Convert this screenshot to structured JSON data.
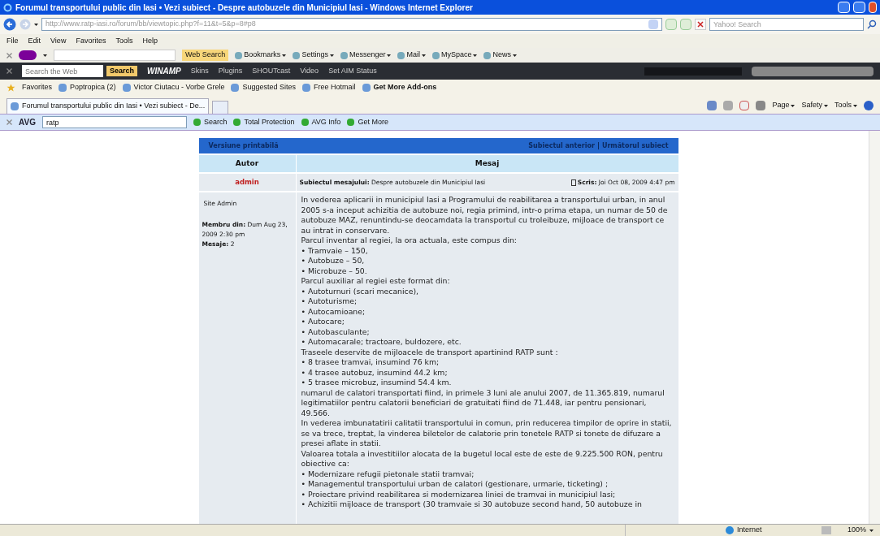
{
  "window": {
    "title": "Forumul transportului public din Iasi • Vezi subiect - Despre autobuzele din Municipiul Iasi - Windows Internet Explorer"
  },
  "address_bar": {
    "url": "http://www.ratp-iasi.ro/forum/bb/viewtopic.php?f=11&t=5&p=8#p8",
    "search_placeholder": "Yahoo! Search"
  },
  "menu": [
    "File",
    "Edit",
    "View",
    "Favorites",
    "Tools",
    "Help"
  ],
  "yahoo_toolbar": {
    "web_search": "Web Search",
    "items": [
      "Bookmarks",
      "Settings",
      "Messenger",
      "Mail",
      "MySpace",
      "News"
    ]
  },
  "winamp_toolbar": {
    "search_placeholder": "Search the Web",
    "search_button": "Search",
    "brand": "WINAMP",
    "items": [
      "Skins",
      "Plugins",
      "SHOUTcast",
      "Video",
      "Set AIM Status"
    ]
  },
  "favorites_bar": {
    "label": "Favorites",
    "items": [
      "Poptropica (2)",
      "Victor Ciutacu - Vorbe Grele",
      "Suggested Sites",
      "Free Hotmail",
      "Get More Add-ons"
    ]
  },
  "tabs": [
    {
      "label": "Forumul transportului public din Iasi • Vezi subiect - De...",
      "selected": true
    }
  ],
  "command_bar": [
    "Page",
    "Safety",
    "Tools"
  ],
  "avg_toolbar": {
    "brand": "AVG",
    "search_value": "ratp",
    "items": [
      "Search",
      "Total Protection",
      "AVG Info",
      "Get More"
    ]
  },
  "forum": {
    "printable": "Versiune printabilă",
    "nav": [
      "Subiectul anterior",
      "Următorul subiect"
    ],
    "columns": [
      "Autor",
      "Mesaj"
    ],
    "post": {
      "author": "admin",
      "subject_label": "Subiectul mesajului:",
      "subject": "Despre autobuzele din Municipiul Iasi",
      "posted_label": "Scris:",
      "posted": "Joi Oct 08, 2009 4:47 pm",
      "rank": "Site Admin",
      "member_label": "Membru din:",
      "member_since": "Dum Aug 23, 2009 2:30 pm",
      "posts_label": "Mesaje:",
      "posts": "2",
      "body": [
        "In vederea aplicarii in municipiul Iasi a Programului de reabilitarea a transportului urban, in anul 2005 s-a inceput achizitia de autobuze noi, regia primind, intr-o prima etapa, un numar de 50 de autobuze MAZ, renuntindu-se deocamdata la transportul cu troleibuze, mijloace de transport ce au intrat in conservare.",
        "Parcul inventar al regiei, la ora actuala, este compus din:",
        "• Tramvaie – 150,",
        "• Autobuze – 50,",
        "• Microbuze – 50.",
        "Parcul auxiliar al regiei este format din:",
        "• Autoturnuri (scari mecanice),",
        "• Autoturisme;",
        "• Autocamioane;",
        "• Autocare;",
        "• Autobasculante;",
        "• Automacarale; tractoare, buldozere, etc.",
        "Traseele deservite de mijloacele de transport apartinind RATP sunt :",
        "• 8 trasee tramvai, insumind 76 km;",
        "• 4 trasee autobuz, insumind 44.2 km;",
        "• 5 trasee microbuz, insumind 54.4 km.",
        "numarul de calatori transportati fiind, in primele 3 luni ale anului 2007, de 11.365.819, numarul legitimatiilor pentru calatorii beneficiari de gratuitati fiind de 71.448, iar pentru pensionari, 49.566.",
        "In vederea imbunatatirii calitatii transportului in comun, prin reducerea timpilor de oprire in statii, se va trece, treptat, la vinderea biletelor de calatorie prin tonetele RATP si tonete de difuzare a presei aflate in statii.",
        "Valoarea totala a investitiilor alocata de la bugetul local este de este de 9.225.500 RON, pentru obiective ca:",
        "• Modernizare refugii pietonale statii tramvai;",
        "• Managementul transportului urban de calatori (gestionare, urmarie, ticketing) ;",
        "• Proiectare privind reabilitarea si modernizarea liniei de tramvai in municipiul Iasi;",
        "• Achizitii mijloace de transport (30 tramvaie si 30 autobuze second hand, 50 autobuze in"
      ]
    }
  },
  "status_bar": {
    "zone": "Internet",
    "zoom": "100%"
  }
}
